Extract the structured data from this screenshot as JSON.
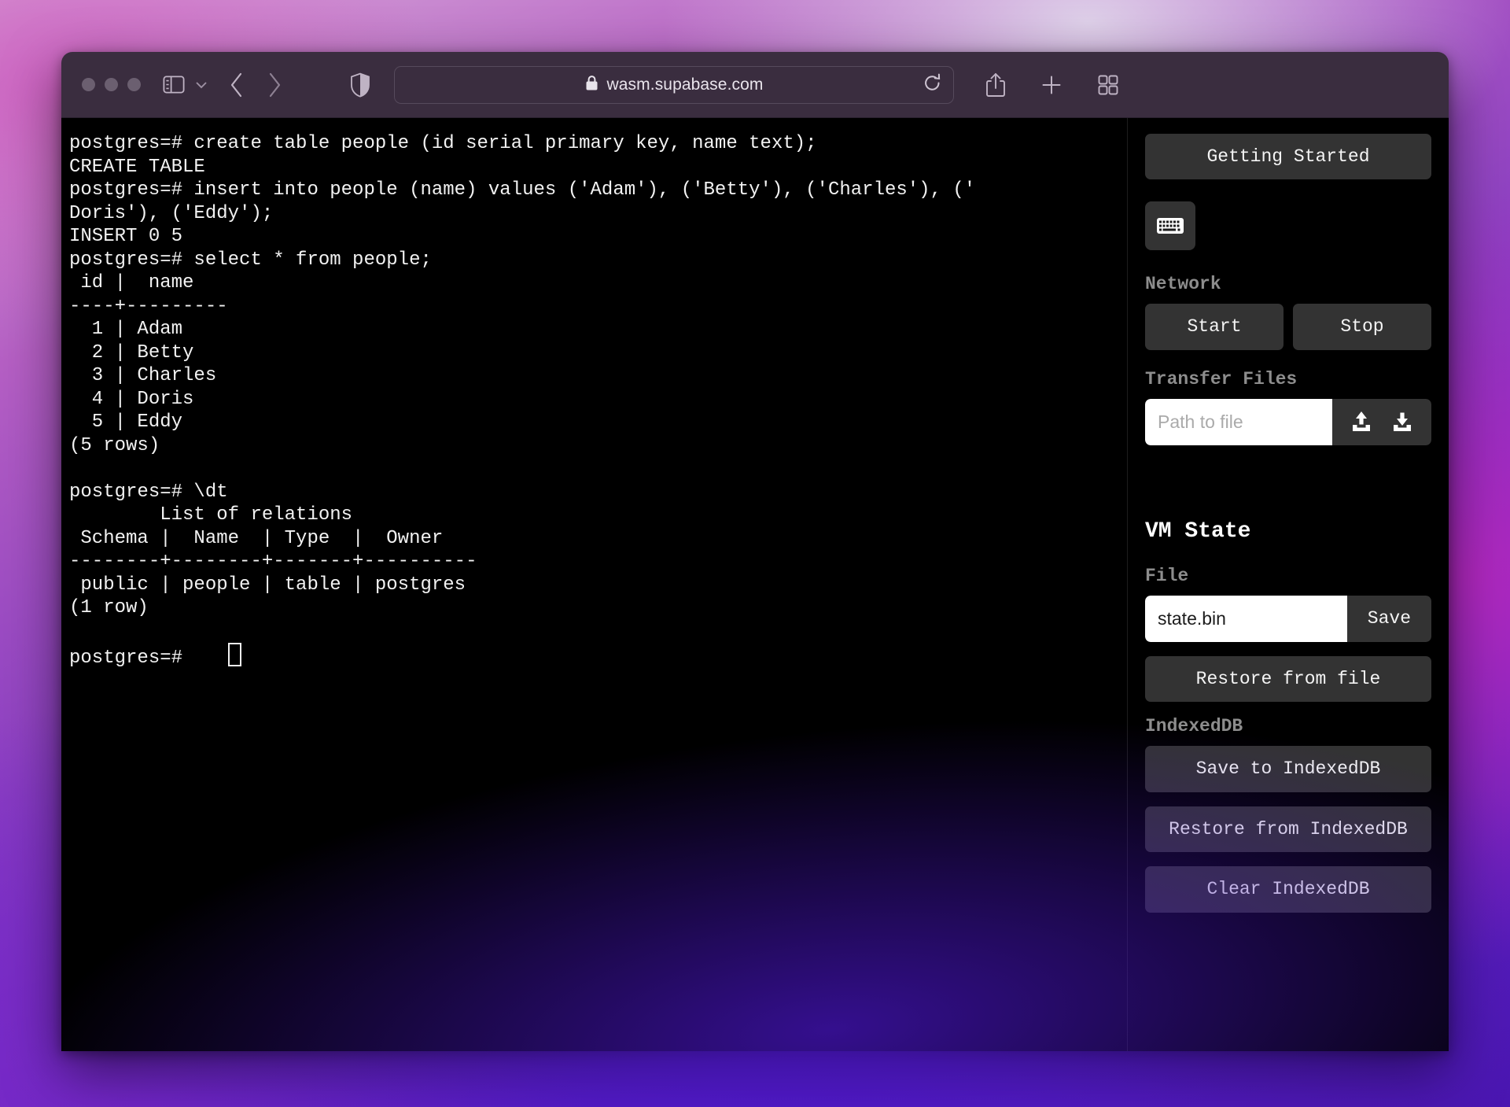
{
  "browser": {
    "url": "wasm.supabase.com",
    "lock_icon": "lock-icon",
    "traffic_lights": [
      "close",
      "minimize",
      "zoom"
    ],
    "toolbar_icons": [
      "sidebar-toggle-icon",
      "chevron-down-icon",
      "back-arrow-icon",
      "forward-arrow-icon",
      "shield-icon",
      "reload-icon",
      "share-icon",
      "new-tab-icon",
      "tab-overview-icon"
    ]
  },
  "terminal": {
    "lines": [
      "postgres=# create table people (id serial primary key, name text);",
      "CREATE TABLE",
      "postgres=# insert into people (name) values ('Adam'), ('Betty'), ('Charles'), ('",
      "Doris'), ('Eddy');",
      "INSERT 0 5",
      "postgres=# select * from people;",
      " id |  name",
      "----+---------",
      "  1 | Adam",
      "  2 | Betty",
      "  3 | Charles",
      "  4 | Doris",
      "  5 | Eddy",
      "(5 rows)",
      "",
      "postgres=# \\dt",
      "        List of relations",
      " Schema |  Name  | Type  |  Owner",
      "--------+--------+-------+----------",
      " public | people | table | postgres",
      "(1 row)",
      ""
    ],
    "prompt": "postgres=#    ",
    "cursor": "missing-glyph-box"
  },
  "panel": {
    "getting_started_label": "Getting Started",
    "keyboard_icon": "keyboard-icon",
    "network": {
      "label": "Network",
      "start_label": "Start",
      "stop_label": "Stop"
    },
    "transfer_files": {
      "label": "Transfer Files",
      "path_placeholder": "Path to file",
      "path_value": "",
      "upload_icon": "upload-icon",
      "download_icon": "download-icon"
    },
    "vm_state": {
      "label": "VM State",
      "file_label": "File",
      "file_value": "state.bin",
      "file_placeholder": "state.bin",
      "save_label": "Save",
      "restore_from_file_label": "Restore from file",
      "indexeddb_label": "IndexedDB",
      "save_to_indexeddb_label": "Save to IndexedDB",
      "restore_from_indexeddb_label": "Restore from IndexedDB",
      "clear_indexeddb_label": "Clear IndexedDB"
    }
  },
  "colors": {
    "toolbar_bg": "#3a2d3f",
    "terminal_bg": "#000000",
    "panel_button_bg": "#333333",
    "text": "#f2f2f2",
    "muted_label": "#8d8d8d"
  }
}
